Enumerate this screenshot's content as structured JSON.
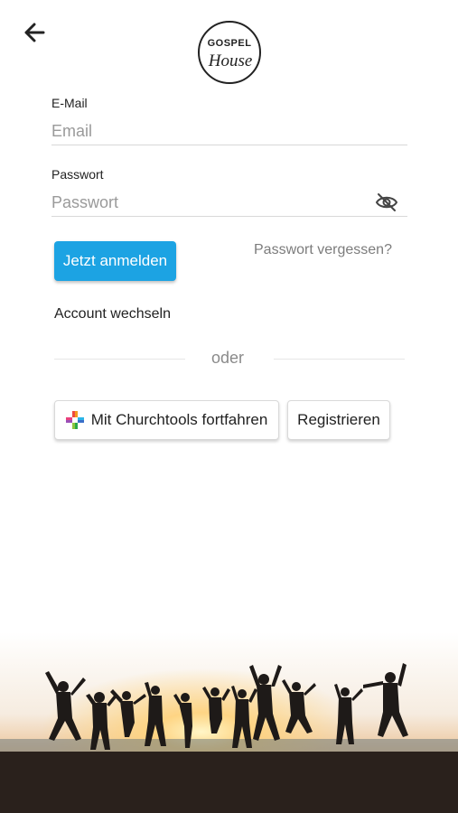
{
  "logo": {
    "line1": "GOSPEL",
    "line2": "House"
  },
  "email": {
    "label": "E-Mail",
    "placeholder": "Email"
  },
  "password": {
    "label": "Passwort",
    "placeholder": "Passwort"
  },
  "actions": {
    "login": "Jetzt anmelden",
    "forgot": "Passwort vergessen?",
    "switch_account": "Account wechseln",
    "divider": "oder",
    "churchtools": "Mit Churchtools fortfahren",
    "register": "Registrieren"
  },
  "colors": {
    "primary": "#1ca3e3"
  },
  "icons": {
    "back": "arrow-left-icon",
    "password_toggle": "eye-off-icon",
    "churchtools": "churchtools-cross-icon"
  }
}
